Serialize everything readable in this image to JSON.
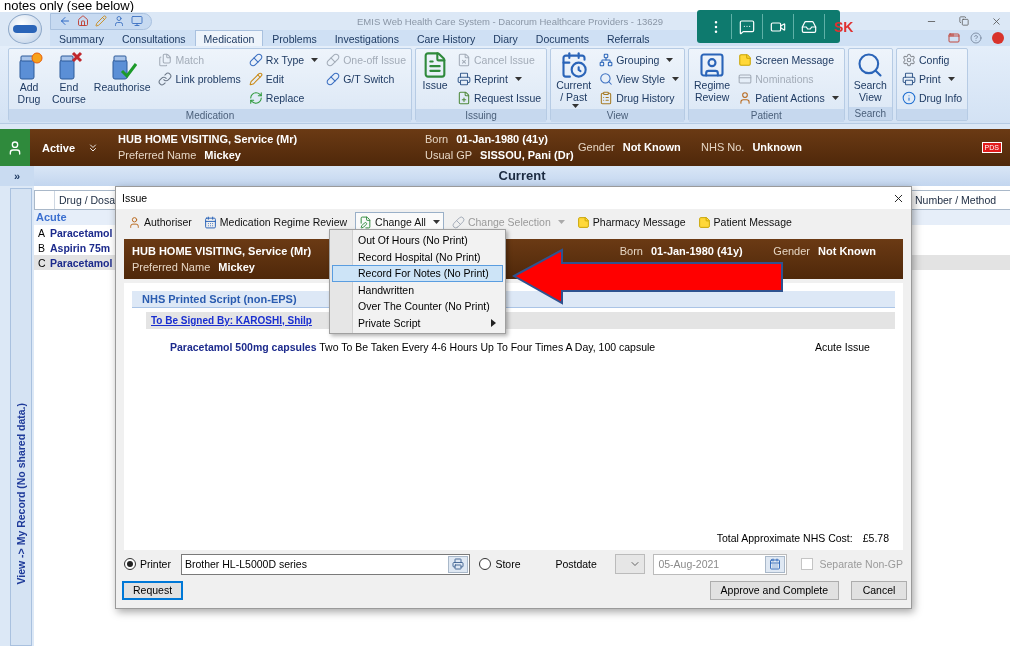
{
  "caption": "notes only (see below)",
  "window": {
    "title": "EMIS Web Health Care System - Dacorum Healthcare Providers - 13629"
  },
  "call_toolbar": {
    "initials": "SK"
  },
  "tabs": [
    {
      "label": "Summary",
      "selected": false
    },
    {
      "label": "Consultations",
      "selected": false
    },
    {
      "label": "Medication",
      "selected": true
    },
    {
      "label": "Problems",
      "selected": false
    },
    {
      "label": "Investigations",
      "selected": false
    },
    {
      "label": "Care History",
      "selected": false
    },
    {
      "label": "Diary",
      "selected": false
    },
    {
      "label": "Documents",
      "selected": false
    },
    {
      "label": "Referrals",
      "selected": false
    }
  ],
  "ribbon": {
    "groups": [
      {
        "label": "Medication",
        "columns": [
          {
            "kind": "large",
            "lines": [
              "Add",
              "Drug"
            ],
            "dropdown": false
          },
          {
            "kind": "large",
            "lines": [
              "End",
              "Course"
            ],
            "dropdown": false
          },
          {
            "kind": "large",
            "lines": [
              "Reauthorise"
            ],
            "dropdown": false
          },
          {
            "kind": "stack",
            "items": [
              {
                "label": "Match",
                "disabled": true,
                "dropdown": false
              },
              {
                "label": "Link problems",
                "disabled": false,
                "dropdown": false
              }
            ]
          },
          {
            "kind": "stack",
            "items": [
              {
                "label": "Rx Type",
                "disabled": false,
                "dropdown": true
              },
              {
                "label": "Edit",
                "disabled": false,
                "dropdown": false
              },
              {
                "label": "Replace",
                "disabled": false,
                "dropdown": false
              }
            ]
          },
          {
            "kind": "stack",
            "items": [
              {
                "label": "One-off Issue",
                "disabled": true,
                "dropdown": false
              },
              {
                "label": "G/T Switch",
                "disabled": false,
                "dropdown": false
              }
            ]
          }
        ]
      },
      {
        "label": "Issuing",
        "columns": [
          {
            "kind": "large",
            "lines": [
              "Issue"
            ],
            "dropdown": false
          },
          {
            "kind": "stack",
            "items": [
              {
                "label": "Cancel Issue",
                "disabled": true,
                "dropdown": false
              },
              {
                "label": "Reprint",
                "disabled": false,
                "dropdown": true
              },
              {
                "label": "Request Issue",
                "disabled": false,
                "dropdown": false
              }
            ]
          }
        ]
      },
      {
        "label": "View",
        "columns": [
          {
            "kind": "large",
            "lines": [
              "Current",
              "/ Past"
            ],
            "dropdown": true
          },
          {
            "kind": "stack",
            "items": [
              {
                "label": "Grouping",
                "disabled": false,
                "dropdown": true
              },
              {
                "label": "View Style",
                "disabled": false,
                "dropdown": true
              },
              {
                "label": "Drug History",
                "disabled": false,
                "dropdown": false
              }
            ]
          }
        ]
      },
      {
        "label": "Patient",
        "columns": [
          {
            "kind": "large",
            "lines": [
              "Regime",
              "Review"
            ],
            "dropdown": false
          },
          {
            "kind": "stack",
            "items": [
              {
                "label": "Screen Message",
                "disabled": false,
                "dropdown": false
              },
              {
                "label": "Nominations",
                "disabled": true,
                "dropdown": false
              },
              {
                "label": "Patient Actions",
                "disabled": false,
                "dropdown": true
              }
            ]
          }
        ]
      },
      {
        "label": "Search",
        "columns": [
          {
            "kind": "large",
            "lines": [
              "Search",
              "View"
            ],
            "dropdown": false
          }
        ]
      },
      {
        "columns": [
          {
            "kind": "stack",
            "items": [
              {
                "label": "Config",
                "disabled": false,
                "dropdown": false
              },
              {
                "label": "Print",
                "disabled": false,
                "dropdown": true
              },
              {
                "label": "Drug Info",
                "disabled": false,
                "dropdown": false
              }
            ]
          }
        ]
      }
    ]
  },
  "patient_banner": {
    "status": "Active",
    "name": "HUB HOME VISITING, Service (Mr)",
    "preferred_name": {
      "label": "Preferred Name",
      "value": "Mickey"
    },
    "born": {
      "label": "Born",
      "value": "01-Jan-1980 (41y)"
    },
    "usual_gp": {
      "label": "Usual GP",
      "value": "SISSOU, Pani (Dr)"
    },
    "gender": {
      "label": "Gender",
      "value": "Not Known"
    },
    "nhs_no": {
      "label": "NHS No.",
      "value": "Unknown"
    },
    "badge": "PDS"
  },
  "side": {
    "collapse": "»",
    "record_link": "View -> My Record (No shared data.)"
  },
  "medication_list": {
    "title": "Current",
    "columns": [
      "Drug / Dosa",
      "Number / Method"
    ],
    "group": "Acute",
    "rows": [
      {
        "letter": "A",
        "drug": "Paracetamol",
        "selected": false
      },
      {
        "letter": "B",
        "drug": "Aspirin 75m",
        "selected": false
      },
      {
        "letter": "C",
        "drug": "Paracetamol",
        "selected": true
      }
    ]
  },
  "dialog": {
    "title": "Issue",
    "toolbar": [
      {
        "label": "Authoriser",
        "dropdown": false,
        "disabled": false,
        "pressed": false
      },
      {
        "label": "Medication Regime Review",
        "dropdown": false,
        "disabled": false,
        "pressed": false
      },
      {
        "label": "Change All",
        "dropdown": true,
        "disabled": false,
        "pressed": true
      },
      {
        "label": "Change Selection",
        "dropdown": true,
        "disabled": true,
        "pressed": false
      },
      {
        "label": "Pharmacy Message",
        "dropdown": false,
        "disabled": false,
        "pressed": false
      },
      {
        "label": "Patient Message",
        "dropdown": false,
        "disabled": false,
        "pressed": false
      }
    ],
    "banner": {
      "name": "HUB HOME VISITING, Service (Mr)",
      "preferred_name": {
        "label": "Preferred Name",
        "value": "Mickey"
      },
      "born": {
        "label": "Born",
        "value": "01-Jan-1980 (41y)"
      },
      "gender": {
        "label": "Gender",
        "value": "Not Known"
      }
    },
    "script": {
      "header": "NHS Printed Script (non-EPS)",
      "signer": "To Be Signed By: KAROSHI, Shilp",
      "items": [
        {
          "drug": "Paracetamol 500mg capsules",
          "directions": "Two To Be Taken Every 4-6 Hours Up To Four Times A Day, 100 capsule",
          "issue_type": "Acute Issue"
        }
      ]
    },
    "total": {
      "label": "Total Approximate NHS Cost:",
      "value": "£5.78"
    },
    "output": [
      {
        "label": "Printer",
        "selected": true
      },
      {
        "label": "Store",
        "selected": false
      }
    ],
    "printer": "Brother HL-L5000D series",
    "postdate": {
      "label": "Postdate",
      "date": "05-Aug-2021"
    },
    "separate_non_gp": {
      "label": "Separate Non-GP",
      "checked": false,
      "disabled": true
    },
    "buttons": [
      {
        "label": "Request",
        "focused": true
      },
      {
        "label": "Approve and Complete",
        "focused": false
      },
      {
        "label": "Cancel",
        "focused": false
      }
    ]
  },
  "menu": {
    "items": [
      {
        "label": "Out Of Hours (No Print)",
        "selected": false,
        "submenu": false
      },
      {
        "label": "Record Hospital (No Print)",
        "selected": false,
        "submenu": false
      },
      {
        "label": "Record For Notes (No Print)",
        "selected": true,
        "submenu": false
      },
      {
        "label": "Handwritten",
        "selected": false,
        "submenu": false
      },
      {
        "label": "Over The Counter (No Print)",
        "selected": false,
        "submenu": false
      },
      {
        "label": "Private Script",
        "selected": false,
        "submenu": true
      }
    ]
  }
}
